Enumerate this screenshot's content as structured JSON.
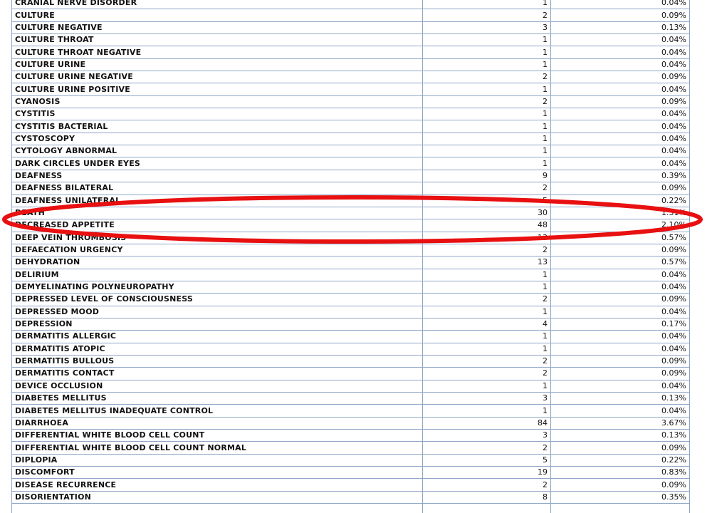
{
  "table": {
    "rows": [
      {
        "term": "CRANIAL NERVE DISORDER",
        "count": "1",
        "pct": "0.04%"
      },
      {
        "term": "CULTURE",
        "count": "2",
        "pct": "0.09%"
      },
      {
        "term": "CULTURE NEGATIVE",
        "count": "3",
        "pct": "0.13%"
      },
      {
        "term": "CULTURE THROAT",
        "count": "1",
        "pct": "0.04%"
      },
      {
        "term": "CULTURE THROAT NEGATIVE",
        "count": "1",
        "pct": "0.04%"
      },
      {
        "term": "CULTURE URINE",
        "count": "1",
        "pct": "0.04%"
      },
      {
        "term": "CULTURE URINE NEGATIVE",
        "count": "2",
        "pct": "0.09%"
      },
      {
        "term": "CULTURE URINE POSITIVE",
        "count": "1",
        "pct": "0.04%"
      },
      {
        "term": "CYANOSIS",
        "count": "2",
        "pct": "0.09%"
      },
      {
        "term": "CYSTITIS",
        "count": "1",
        "pct": "0.04%"
      },
      {
        "term": "CYSTITIS BACTERIAL",
        "count": "1",
        "pct": "0.04%"
      },
      {
        "term": "CYSTOSCOPY",
        "count": "1",
        "pct": "0.04%"
      },
      {
        "term": "CYTOLOGY ABNORMAL",
        "count": "1",
        "pct": "0.04%"
      },
      {
        "term": "DARK CIRCLES UNDER EYES",
        "count": "1",
        "pct": "0.04%"
      },
      {
        "term": "DEAFNESS",
        "count": "9",
        "pct": "0.39%"
      },
      {
        "term": "DEAFNESS BILATERAL",
        "count": "2",
        "pct": "0.09%"
      },
      {
        "term": "DEAFNESS UNILATERAL",
        "count": "5",
        "pct": "0.22%"
      },
      {
        "term": "DEATH",
        "count": "30",
        "pct": "1.31%"
      },
      {
        "term": "DECREASED APPETITE",
        "count": "48",
        "pct": "2.10%"
      },
      {
        "term": "DEEP VEIN THROMBOSIS",
        "count": "13",
        "pct": "0.57%"
      },
      {
        "term": "DEFAECATION URGENCY",
        "count": "2",
        "pct": "0.09%"
      },
      {
        "term": "DEHYDRATION",
        "count": "13",
        "pct": "0.57%"
      },
      {
        "term": "DELIRIUM",
        "count": "1",
        "pct": "0.04%"
      },
      {
        "term": "DEMYELINATING POLYNEUROPATHY",
        "count": "1",
        "pct": "0.04%"
      },
      {
        "term": "DEPRESSED LEVEL OF CONSCIOUSNESS",
        "count": "2",
        "pct": "0.09%"
      },
      {
        "term": "DEPRESSED MOOD",
        "count": "1",
        "pct": "0.04%"
      },
      {
        "term": "DEPRESSION",
        "count": "4",
        "pct": "0.17%"
      },
      {
        "term": "DERMATITIS ALLERGIC",
        "count": "1",
        "pct": "0.04%"
      },
      {
        "term": "DERMATITIS ATOPIC",
        "count": "1",
        "pct": "0.04%"
      },
      {
        "term": "DERMATITIS BULLOUS",
        "count": "2",
        "pct": "0.09%"
      },
      {
        "term": "DERMATITIS CONTACT",
        "count": "2",
        "pct": "0.09%"
      },
      {
        "term": "DEVICE OCCLUSION",
        "count": "1",
        "pct": "0.04%"
      },
      {
        "term": "DIABETES MELLITUS",
        "count": "3",
        "pct": "0.13%"
      },
      {
        "term": "DIABETES MELLITUS INADEQUATE CONTROL",
        "count": "1",
        "pct": "0.04%"
      },
      {
        "term": "DIARRHOEA",
        "count": "84",
        "pct": "3.67%"
      },
      {
        "term": "DIFFERENTIAL WHITE BLOOD CELL COUNT",
        "count": "3",
        "pct": "0.13%"
      },
      {
        "term": "DIFFERENTIAL WHITE BLOOD CELL COUNT NORMAL",
        "count": "2",
        "pct": "0.09%"
      },
      {
        "term": "DIPLOPIA",
        "count": "5",
        "pct": "0.22%"
      },
      {
        "term": "DISCOMFORT",
        "count": "19",
        "pct": "0.83%"
      },
      {
        "term": "DISEASE RECURRENCE",
        "count": "2",
        "pct": "0.09%"
      },
      {
        "term": "DISORIENTATION",
        "count": "8",
        "pct": "0.35%"
      },
      {
        "term": "",
        "count": "",
        "pct": ""
      }
    ]
  },
  "highlight": {
    "color": "#e81010",
    "row_term": "DEATH"
  },
  "colors": {
    "grid_border": "#8fa6c8",
    "text": "#111111"
  }
}
